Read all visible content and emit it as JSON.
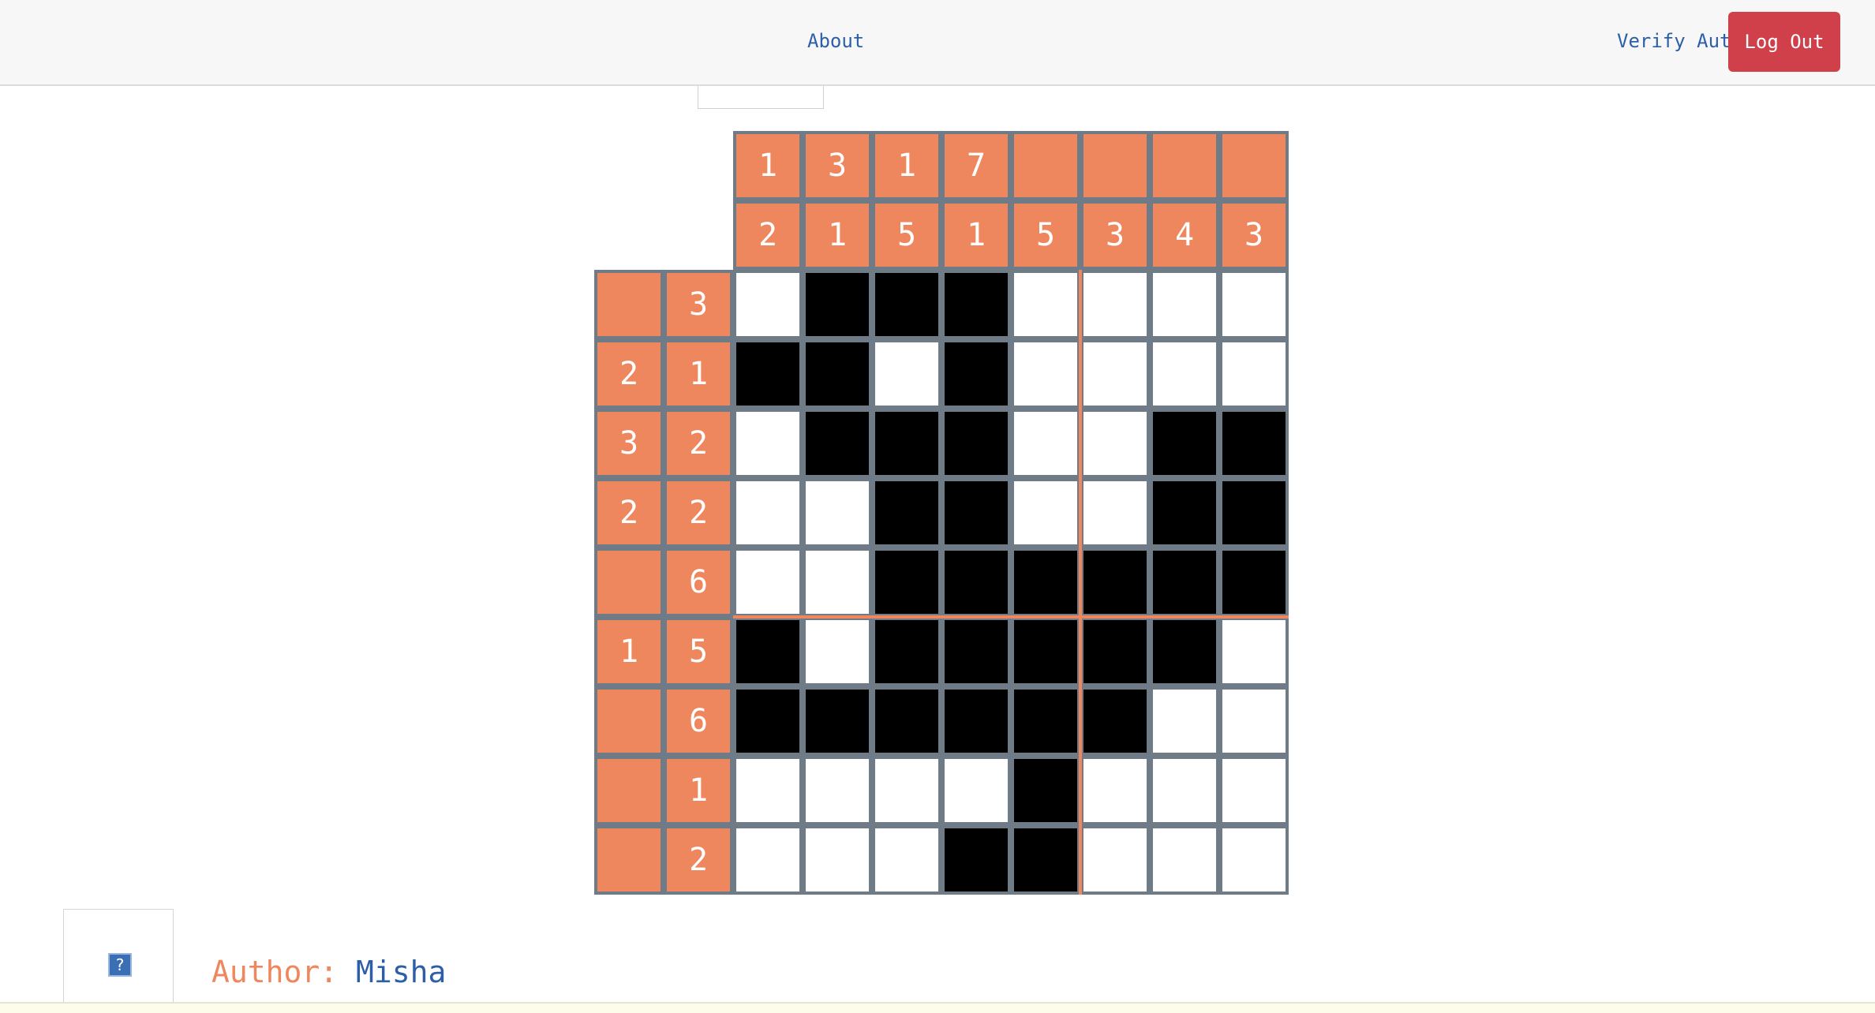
{
  "nav": {
    "about_label": "About",
    "verify_label": "Verify Auth",
    "logout_label": "Log Out"
  },
  "help": {
    "icon": "question-mark-icon",
    "glyph": "?"
  },
  "author": {
    "label": "Author:",
    "name": "Misha"
  },
  "colors": {
    "clue": "#ef875e",
    "grid_line": "#6f7b87",
    "filled": "#000000",
    "empty": "#ffffff",
    "logout": "#d0404a",
    "link": "#2d5fa8"
  },
  "puzzle": {
    "cols": 8,
    "rows": 9,
    "column_clues": [
      [
        "1",
        "2"
      ],
      [
        "3",
        "1"
      ],
      [
        "1",
        "5"
      ],
      [
        "7",
        "1"
      ],
      [
        "",
        "5"
      ],
      [
        "",
        "3"
      ],
      [
        "",
        "4"
      ],
      [
        "",
        "3"
      ]
    ],
    "row_clues": [
      [
        "",
        "3"
      ],
      [
        "2",
        "1"
      ],
      [
        "3",
        "2"
      ],
      [
        "2",
        "2"
      ],
      [
        "",
        "6"
      ],
      [
        "1",
        "5"
      ],
      [
        "",
        "6"
      ],
      [
        "",
        "1"
      ],
      [
        "",
        "2"
      ]
    ],
    "grid": [
      [
        0,
        1,
        1,
        1,
        0,
        0,
        0,
        0
      ],
      [
        1,
        1,
        0,
        1,
        0,
        0,
        0,
        0
      ],
      [
        0,
        1,
        1,
        1,
        0,
        0,
        1,
        1
      ],
      [
        0,
        0,
        1,
        1,
        0,
        0,
        1,
        1
      ],
      [
        0,
        0,
        1,
        1,
        1,
        1,
        1,
        1
      ],
      [
        1,
        0,
        1,
        1,
        1,
        1,
        1,
        0
      ],
      [
        1,
        1,
        1,
        1,
        1,
        1,
        0,
        0
      ],
      [
        0,
        0,
        0,
        0,
        1,
        0,
        0,
        0
      ],
      [
        0,
        0,
        0,
        1,
        1,
        0,
        0,
        0
      ]
    ]
  }
}
